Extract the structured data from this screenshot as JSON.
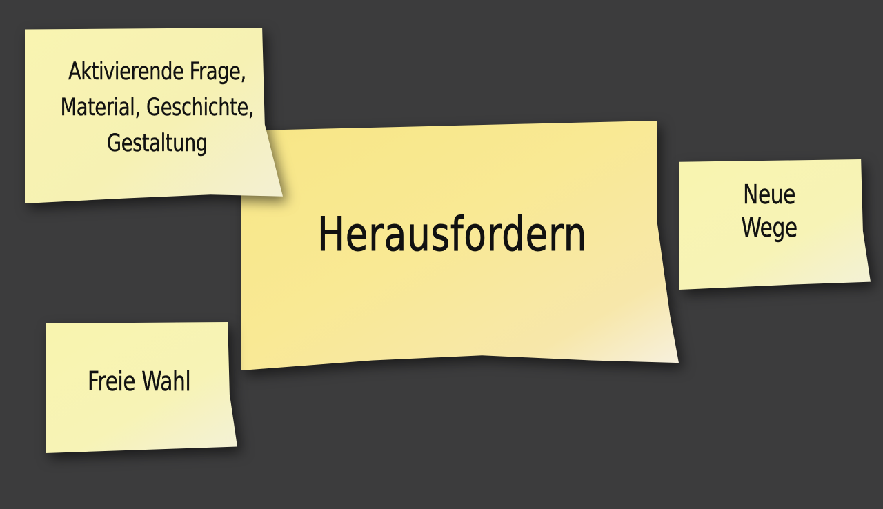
{
  "notes": {
    "activating": {
      "text": "Aktivierende Frage,\nMaterial, Geschichte,\nGestaltung"
    },
    "main": {
      "text": "Herausfordern"
    },
    "new_ways": {
      "text": "Neue\nWege"
    },
    "free_choice": {
      "text": "Freie Wahl"
    }
  },
  "colors": {
    "background": "#3c3c3d",
    "note_yellow": "#f8f4b0",
    "main_note_yellow": "#f8e78c",
    "ink": "#111111"
  }
}
